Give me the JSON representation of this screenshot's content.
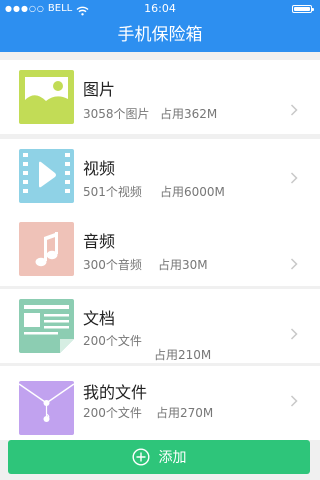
{
  "status_bar": {
    "signal": "●●●○○",
    "carrier": "BELL",
    "time": "16:04"
  },
  "nav": {
    "title": "手机保险箱"
  },
  "items": [
    {
      "title": "图片",
      "count": "3058个图片",
      "usage": "占用362M",
      "icon": "image-icon",
      "color": "#c2dc56"
    },
    {
      "title": "视频",
      "count": "501个视频",
      "usage": "占用6000M",
      "icon": "video-icon",
      "color": "#8fd2e6"
    },
    {
      "title": "音频",
      "count": "300个音频",
      "usage": "占用30M",
      "icon": "music-icon",
      "color": "#efc2b8"
    },
    {
      "title": "文档",
      "count": "200个文件",
      "usage": "占用210M",
      "icon": "document-icon",
      "color": "#8ccdb2"
    },
    {
      "title": "我的文件",
      "count": "200个文件",
      "usage": "占用270M",
      "icon": "folder-icon",
      "color": "#c1a2ef"
    }
  ],
  "add_button": {
    "label": "添加"
  },
  "colors": {
    "primary": "#2d8ff0",
    "accent": "#2ec57a"
  }
}
